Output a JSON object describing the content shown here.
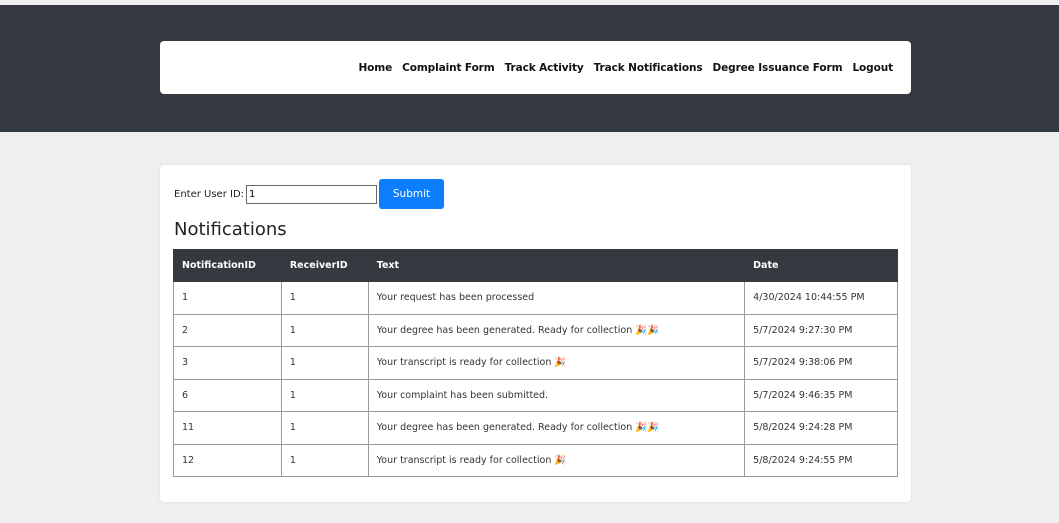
{
  "nav": {
    "items": [
      "Home",
      "Complaint Form",
      "Track Activity",
      "Track Notifications",
      "Degree Issuance Form",
      "Logout"
    ]
  },
  "form": {
    "label": "Enter User ID:",
    "user_id_value": "1",
    "submit_label": "Submit"
  },
  "section_title": "Notifications",
  "table": {
    "headers": [
      "NotificationID",
      "ReceiverID",
      "Text",
      "Date"
    ],
    "rows": [
      [
        "1",
        "1",
        "Your request has been processed",
        "4/30/2024 10:44:55 PM"
      ],
      [
        "2",
        "1",
        "Your degree has been generated. Ready for collection 🎉🎉",
        "5/7/2024 9:27:30 PM"
      ],
      [
        "3",
        "1",
        "Your transcript is ready for collection 🎉",
        "5/7/2024 9:38:06 PM"
      ],
      [
        "6",
        "1",
        "Your complaint has been submitted.",
        "5/7/2024 9:46:35 PM"
      ],
      [
        "11",
        "1",
        "Your degree has been generated. Ready for collection 🎉🎉",
        "5/8/2024 9:24:28 PM"
      ],
      [
        "12",
        "1",
        "Your transcript is ready for collection 🎉",
        "5/8/2024 9:24:55 PM"
      ]
    ]
  },
  "colors": {
    "header_dark": "#343a40",
    "page_bg": "#efefef",
    "button_blue": "#0d7efb"
  }
}
